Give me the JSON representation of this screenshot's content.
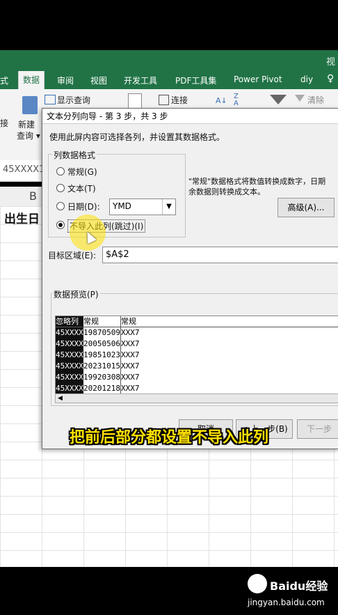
{
  "ribbon": {
    "title_right": "视",
    "tabs": [
      "式",
      "数据",
      "审阅",
      "视图",
      "开发工具",
      "PDF工具集",
      "Power Pivot",
      "diy"
    ],
    "show_query": "显示查询",
    "connections": "连接",
    "clear": "清除",
    "new_query": "新建",
    "new_query2": "查询 ▾",
    "left_cut": "接"
  },
  "sheet": {
    "name_box": "45XXXX1",
    "col_b": "B",
    "cell_text": "出生日"
  },
  "dialog": {
    "title": "文本分列向导 - 第 3 步，共 3 步",
    "instruction": "使用此屏内容可选择各列，并设置其数据格式。",
    "group_label": "列数据格式",
    "opt_general": "常规(G)",
    "opt_text": "文本(T)",
    "opt_date": "日期(D):",
    "date_value": "YMD",
    "opt_skip": "不导入此列(跳过)(I)",
    "note_line1": "\"常规\"数据格式将数值转换成数字，日期",
    "note_line2": "余数据则转换成文本。",
    "advanced": "高级(A)...",
    "dest_label": "目标区域(E):",
    "dest_value": "$A$2",
    "preview_label": "数据预览(P)",
    "preview_headers": [
      "忽略列",
      "常规",
      "常规"
    ],
    "preview_rows": [
      [
        "45XXXX",
        "19870509",
        "XXX7"
      ],
      [
        "45XXXX",
        "20050506",
        "XXX7"
      ],
      [
        "45XXXX",
        "19851023",
        "XXX7"
      ],
      [
        "45XXXX",
        "20231015",
        "XXX7"
      ],
      [
        "45XXXX",
        "19920308",
        "XXX7"
      ],
      [
        "45XXXX",
        "20201218",
        "XXX7"
      ]
    ],
    "btn_cancel": "取消",
    "btn_back": "< 上一步(B)",
    "btn_next": "下一步"
  },
  "caption": "把前后部分都设置不导入此列",
  "watermark": {
    "brand": "Baidu经验",
    "url": "jingyan.baidu.com"
  },
  "colors": {
    "excel_green": "#217346",
    "subtitle_yellow": "#ffe100"
  }
}
